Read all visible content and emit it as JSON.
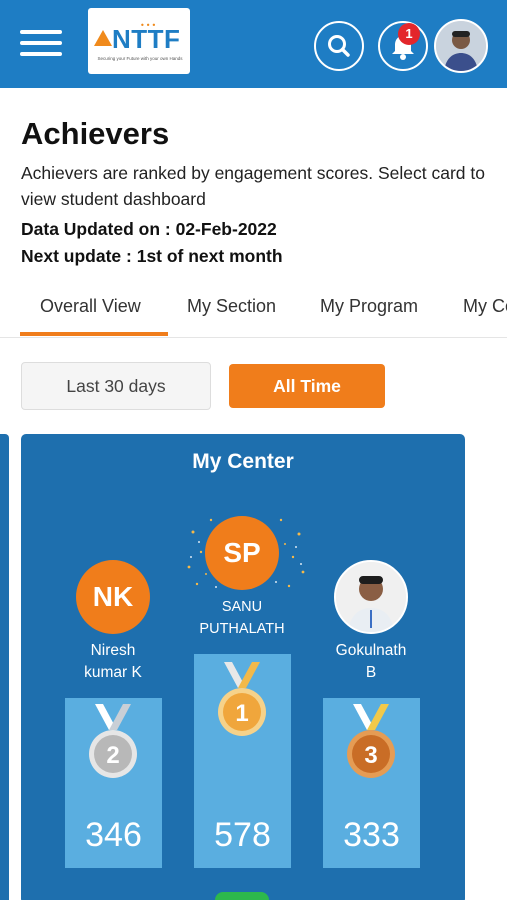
{
  "header": {
    "logo_text": "NTTF",
    "logo_tagline": "Securing your Future with your own Hands",
    "notification_count": "1",
    "colors": {
      "bar": "#1e7dc4",
      "accent": "#f07d1b",
      "badge": "#e3262b"
    },
    "icons": [
      "menu-icon",
      "search-icon",
      "bell-icon"
    ]
  },
  "page": {
    "title": "Achievers",
    "description": "Achievers are ranked by engagement scores. Select card to view student dashboard",
    "updated": "Data Updated on : 02-Feb-2022",
    "next_update": "Next update : 1st of next month"
  },
  "tabs": [
    {
      "label": "Overall View",
      "active": true
    },
    {
      "label": "My Section",
      "active": false
    },
    {
      "label": "My Program",
      "active": false
    },
    {
      "label": "My Co",
      "active": false
    }
  ],
  "filters": {
    "last30": "Last 30 days",
    "alltime": "All Time",
    "selected": "All Time"
  },
  "card": {
    "title": "My Center",
    "first": {
      "initials": "SP",
      "name_line1": "SANU",
      "name_line2": "PUTHALATH",
      "rank": "1",
      "score": "578"
    },
    "second": {
      "initials": "NK",
      "name_line1": "Niresh",
      "name_line2": "kumar K",
      "rank": "2",
      "score": "346"
    },
    "third": {
      "name_line1": "Gokulnath",
      "name_line2": "B",
      "rank": "3",
      "score": "333"
    }
  }
}
